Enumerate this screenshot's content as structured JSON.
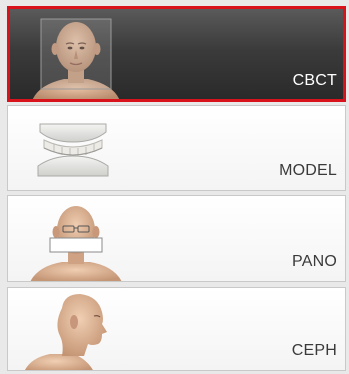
{
  "modes": [
    {
      "id": "cbct",
      "label": "CBCT",
      "selected": true,
      "icon": "head-scan-icon"
    },
    {
      "id": "model",
      "label": "MODEL",
      "selected": false,
      "icon": "dental-model-icon"
    },
    {
      "id": "pano",
      "label": "PANO",
      "selected": false,
      "icon": "panoramic-head-icon"
    },
    {
      "id": "ceph",
      "label": "CEPH",
      "selected": false,
      "icon": "head-profile-icon"
    }
  ],
  "colors": {
    "selected_border": "#d8131b",
    "selected_background": "#3b3b3b",
    "tile_background": "#ffffff",
    "label_dark": "#3a3a3a",
    "label_light": "#ffffff"
  }
}
